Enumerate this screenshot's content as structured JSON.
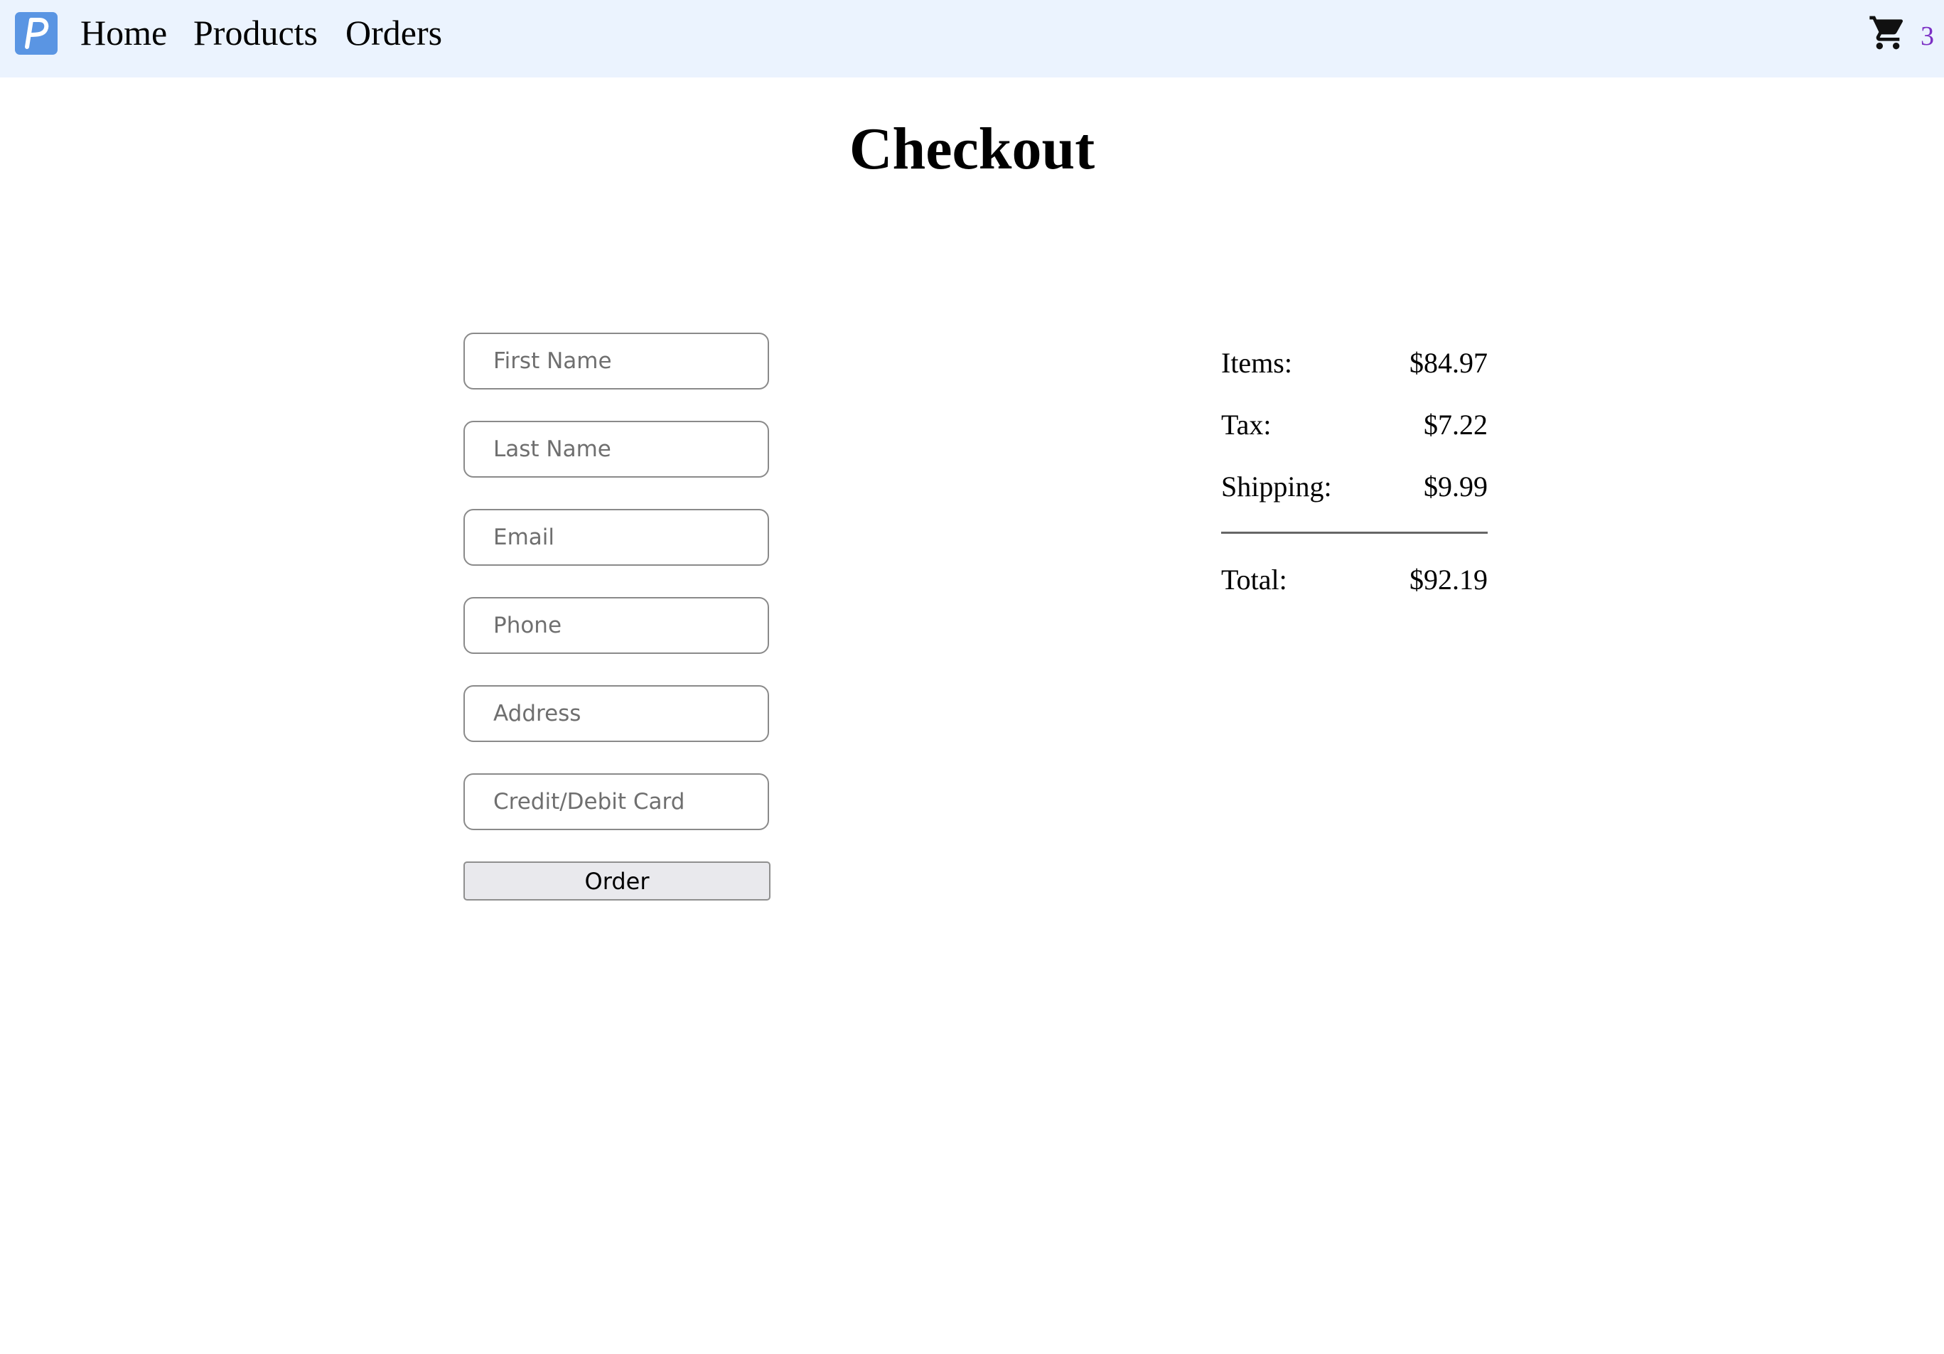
{
  "nav": {
    "logo_letter": "P",
    "links": [
      "Home",
      "Products",
      "Orders"
    ],
    "cart_count": "3"
  },
  "page": {
    "title": "Checkout"
  },
  "form": {
    "fields": [
      {
        "placeholder": "First Name",
        "value": ""
      },
      {
        "placeholder": "Last Name",
        "value": ""
      },
      {
        "placeholder": "Email",
        "value": ""
      },
      {
        "placeholder": "Phone",
        "value": ""
      },
      {
        "placeholder": "Address",
        "value": ""
      },
      {
        "placeholder": "Credit/Debit Card",
        "value": ""
      }
    ],
    "submit_label": "Order"
  },
  "summary": {
    "items_label": "Items:",
    "items_value": "$84.97",
    "tax_label": "Tax:",
    "tax_value": "$7.22",
    "shipping_label": "Shipping:",
    "shipping_value": "$9.99",
    "total_label": "Total:",
    "total_value": "$92.19"
  },
  "colors": {
    "topbar_bg": "#ebf3fe",
    "logo_bg": "#5a95e3",
    "cart_count": "#7b2fc4"
  },
  "icons": {
    "logo": "p-logo-icon",
    "cart": "shopping-cart-icon"
  }
}
